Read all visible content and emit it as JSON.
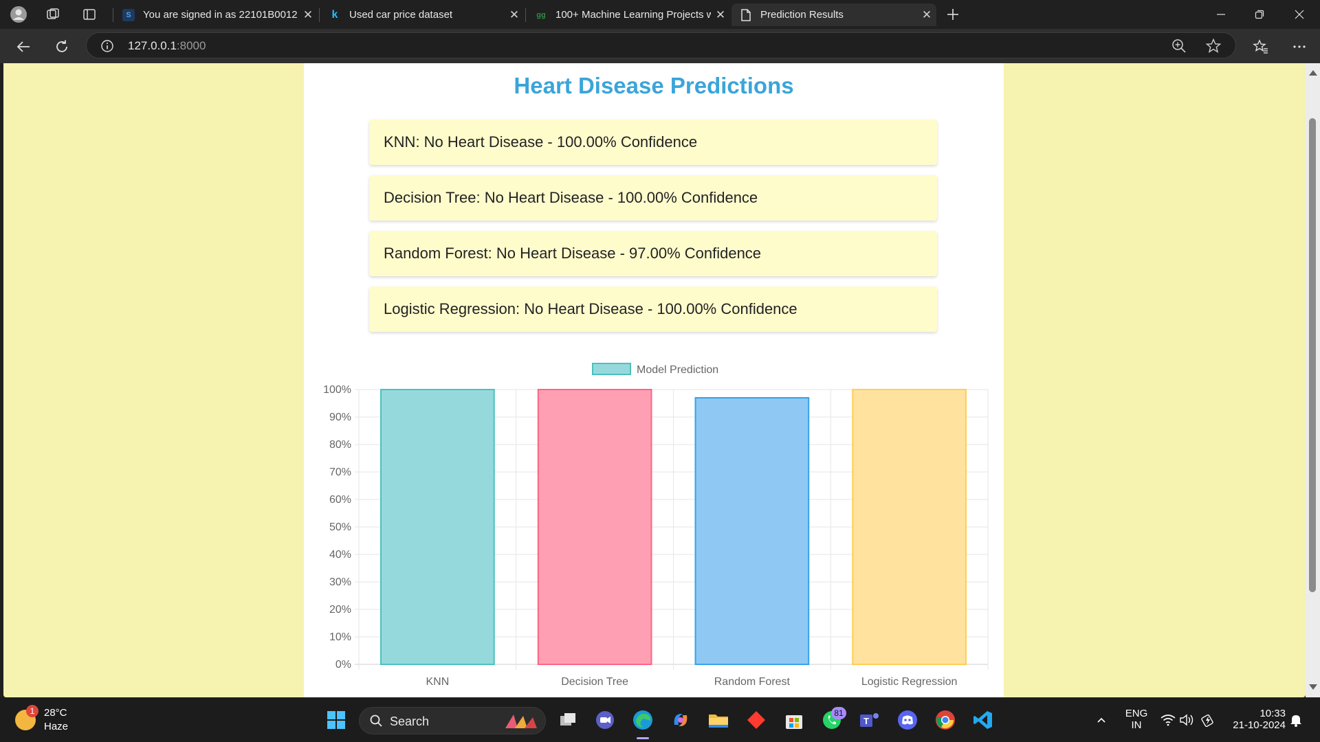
{
  "browser": {
    "tabs": [
      {
        "title": "You are signed in as 22101B0012",
        "favicon": "S",
        "active": false
      },
      {
        "title": "Used car price dataset",
        "favicon": "k",
        "active": false
      },
      {
        "title": "100+ Machine Learning Projects w",
        "favicon": "gg",
        "active": false
      },
      {
        "title": "Prediction Results",
        "favicon": "page-icon",
        "active": true
      }
    ],
    "address": {
      "host": "127.0.0.1",
      "port": ":8000"
    }
  },
  "page": {
    "title": "Heart Disease Predictions",
    "title_color": "#3aa5d9",
    "predictions": [
      "KNN: No Heart Disease - 100.00% Confidence",
      "Decision Tree: No Heart Disease - 100.00% Confidence",
      "Random Forest: No Heart Disease - 97.00% Confidence",
      "Logistic Regression: No Heart Disease - 100.00% Confidence"
    ]
  },
  "chart_data": {
    "type": "bar",
    "categories": [
      "KNN",
      "Decision Tree",
      "Random Forest",
      "Logistic Regression"
    ],
    "series": [
      {
        "name": "Model Prediction",
        "values": [
          100,
          100,
          97,
          100
        ]
      }
    ],
    "ylim": [
      0,
      100
    ],
    "yticks": [
      "0%",
      "10%",
      "20%",
      "30%",
      "40%",
      "50%",
      "60%",
      "70%",
      "80%",
      "90%",
      "100%"
    ],
    "ytick_values": [
      0,
      10,
      20,
      30,
      40,
      50,
      60,
      70,
      80,
      90,
      100
    ],
    "fills": [
      "#96d9dc",
      "#ff9fb3",
      "#8ec8f3",
      "#ffe29e"
    ],
    "strokes": [
      "#4bc0c0",
      "#ff6384",
      "#36a2eb",
      "#ffcd56"
    ],
    "legend_fill": "#96d9dc",
    "legend_stroke": "#4bc0c0",
    "legend_position": "top",
    "grid": true
  },
  "taskbar": {
    "weather": {
      "temp": "28°C",
      "desc": "Haze",
      "badge": "1"
    },
    "search_label": "Search",
    "whatsapp_badge": "81",
    "lang_top": "ENG",
    "lang_bottom": "IN",
    "time": "10:33",
    "date": "21-10-2024"
  }
}
